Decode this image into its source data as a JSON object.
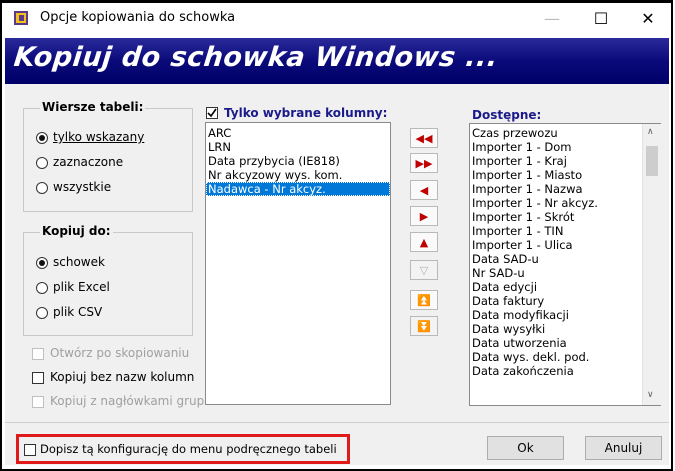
{
  "window": {
    "title": "Opcje kopiowania do schowka",
    "minimize": "—",
    "maximize": "☐",
    "close": "✕"
  },
  "banner": {
    "text": "Kopiuj do schowka Windows ..."
  },
  "rows_group": {
    "title": "Wiersze tabeli:",
    "options": [
      {
        "label": "tylko wskazany",
        "checked": true
      },
      {
        "label": "zaznaczone",
        "checked": false
      },
      {
        "label": "wszystkie",
        "checked": false
      }
    ]
  },
  "copyto_group": {
    "title": "Kopiuj do:",
    "options": [
      {
        "label": "schowek",
        "checked": true
      },
      {
        "label": "plik Excel",
        "checked": false
      },
      {
        "label": "plik CSV",
        "checked": false
      }
    ]
  },
  "checks": {
    "open_after": {
      "label": "Otwórz po skopiowaniu",
      "disabled": true
    },
    "no_headers": {
      "label": "Kopiuj bez nazw kolumn",
      "disabled": false
    },
    "group_headers": {
      "label": "Kopiuj z nagłówkami grup",
      "disabled": true
    }
  },
  "selected_columns": {
    "label": "Tylko wybrane kolumny:",
    "checked": true,
    "items": [
      "ARC",
      "LRN",
      "Data przybycia (IE818)",
      "Nr akcyzowy wys. kom.",
      "Nadawca - Nr akcyz."
    ],
    "selected_index": 4
  },
  "arrows": [
    {
      "name": "move-all-left-button",
      "glyph": "◀◀",
      "disabled": false
    },
    {
      "name": "move-all-right-button",
      "glyph": "▶▶",
      "disabled": false
    },
    {
      "name": "move-left-button",
      "glyph": "◀",
      "disabled": false
    },
    {
      "name": "move-right-button",
      "glyph": "▶",
      "disabled": false
    },
    {
      "name": "move-up-button",
      "glyph": "▲",
      "disabled": false
    },
    {
      "name": "move-down-button",
      "glyph": "▽",
      "disabled": true
    },
    {
      "name": "move-top-button",
      "glyph": "⏫",
      "disabled": false
    },
    {
      "name": "move-bottom-button",
      "glyph": "⏬",
      "disabled": true
    }
  ],
  "available": {
    "label": "Dostępne:",
    "items": [
      "Czas przewozu",
      "Importer 1 - Dom",
      "Importer 1 - Kraj",
      "Importer 1 - Miasto",
      "Importer 1 - Nazwa",
      "Importer 1 - Nr akcyz.",
      "Importer 1 - Skrót",
      "Importer 1 - TIN",
      "Importer 1 - Ulica",
      "Data SAD-u",
      "Nr SAD-u",
      "Data edycji",
      "Data faktury",
      "Data modyfikacji",
      "Data wysyłki",
      "Data utworzenia",
      "Data wys. dekl. pod.",
      "Data zakończenia"
    ]
  },
  "bottom": {
    "add_to_menu": "Dopisz tą konfigurację do menu podręcznego tabeli",
    "ok": "Ok",
    "cancel": "Anuluj"
  },
  "colors": {
    "banner": "#0a0a7a",
    "highlight": "#e01a1a",
    "selection": "#0078d7",
    "arrow": "#c00000"
  }
}
